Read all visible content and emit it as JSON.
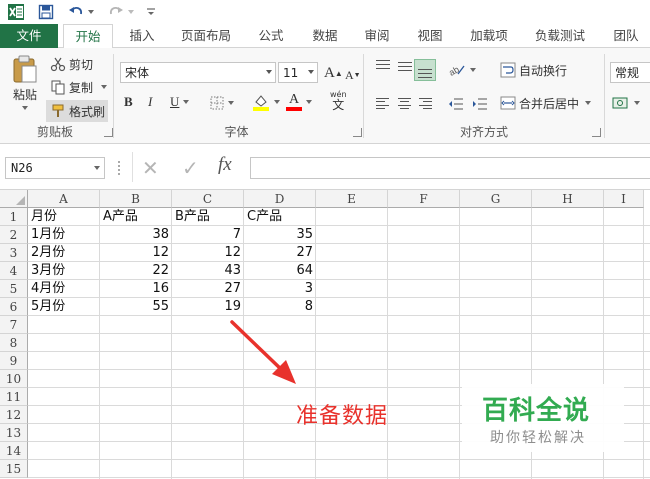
{
  "qat": {
    "app_icon": "excel-logo-icon",
    "save_icon": "save-icon",
    "undo_icon": "undo-icon",
    "redo_icon": "redo-icon",
    "customize_icon": "customize-qat-icon"
  },
  "tabs": [
    "文件",
    "开始",
    "插入",
    "页面布局",
    "公式",
    "数据",
    "审阅",
    "视图",
    "加载项",
    "负载测试",
    "团队"
  ],
  "active_tab": "开始",
  "ribbon": {
    "clipboard": {
      "paste_label": "粘贴",
      "cut_label": "剪切",
      "copy_label": "复制",
      "format_painter_label": "格式刷",
      "group_label": "剪贴板"
    },
    "font": {
      "font_name": "宋体",
      "font_size": "11",
      "grow_font": "A",
      "shrink_font": "A",
      "bold": "B",
      "italic": "I",
      "underline": "U",
      "font_color_letter": "A",
      "phonetic_label": "wén",
      "phonetic_letter": "文",
      "group_label": "字体"
    },
    "alignment": {
      "wrap_text_label": "自动换行",
      "merge_center_label": "合并后居中",
      "group_label": "对齐方式"
    },
    "number": {
      "format_value": "常规"
    }
  },
  "formula_bar": {
    "name_box": "N26",
    "cancel_icon": "✕",
    "enter_icon": "✓",
    "fx_label": "fx",
    "formula": ""
  },
  "grid": {
    "columns": [
      "A",
      "B",
      "C",
      "D",
      "E",
      "F",
      "G",
      "H",
      "I"
    ],
    "rows": [
      "1",
      "2",
      "3",
      "4",
      "5",
      "6",
      "7",
      "8",
      "9",
      "10",
      "11",
      "12",
      "13",
      "14",
      "15"
    ],
    "header": [
      "月份",
      "A产品",
      "B产品",
      "C产品"
    ],
    "data": [
      [
        "1月份",
        "38",
        "7",
        "35"
      ],
      [
        "2月份",
        "12",
        "12",
        "27"
      ],
      [
        "3月份",
        "22",
        "43",
        "64"
      ],
      [
        "4月份",
        "16",
        "27",
        "3"
      ],
      [
        "5月份",
        "55",
        "19",
        "8"
      ]
    ]
  },
  "annotation": {
    "text": "准备数据",
    "color": "#e8322c"
  },
  "watermark": {
    "title": "百科全说",
    "subtitle": "助你轻松解决",
    "color": "#2aa84a"
  },
  "colors": {
    "excel_green": "#217346",
    "highlight_yellow": "#ffff00",
    "font_red": "#ff0000"
  }
}
